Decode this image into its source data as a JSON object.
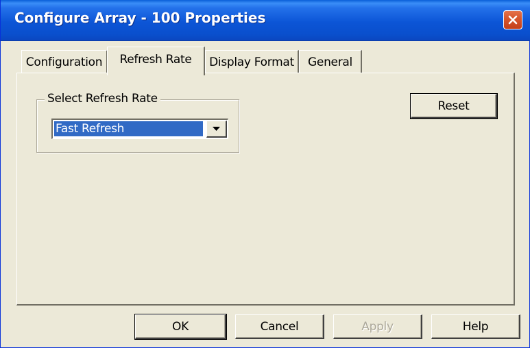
{
  "window": {
    "title": "Configure Array - 100 Properties",
    "close_icon": "close-x-icon"
  },
  "tabs": [
    {
      "label": "Configuration",
      "active": false
    },
    {
      "label": "Refresh Rate",
      "active": true
    },
    {
      "label": "Display Format",
      "active": false
    },
    {
      "label": "General",
      "active": false
    }
  ],
  "refresh": {
    "group_label": "Select Refresh Rate",
    "selected_value": "Fast Refresh",
    "dropdown_icon": "chevron-down-icon",
    "reset_label": "Reset"
  },
  "footer": {
    "ok_label": "OK",
    "cancel_label": "Cancel",
    "apply_label": "Apply",
    "apply_enabled": false,
    "help_label": "Help"
  },
  "colors": {
    "titlebar": "#0a4fcd",
    "close_button": "#d7582e",
    "selection": "#316ac5",
    "face": "#ece9d8"
  }
}
